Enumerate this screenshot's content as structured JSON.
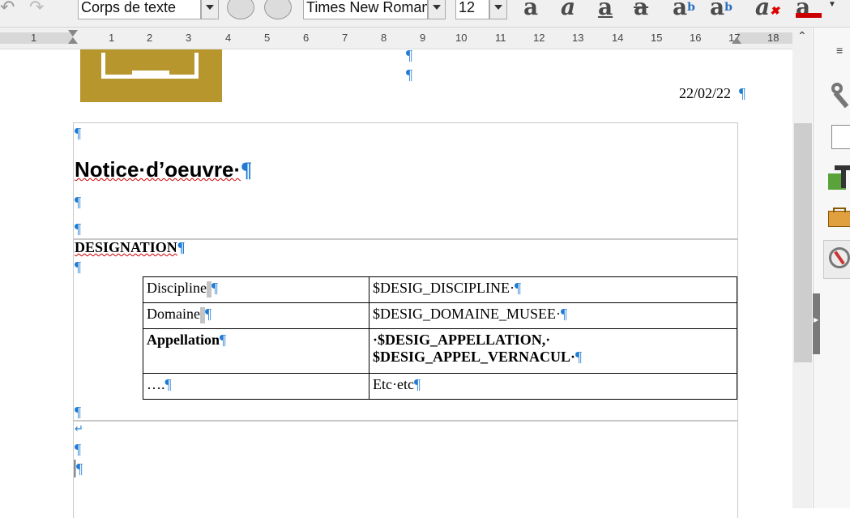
{
  "toolbar": {
    "paragraph_style": "Corps de texte",
    "font_name": "Times New Roman",
    "font_size": "12",
    "icons": [
      "undo-icon",
      "redo-icon",
      "update-style-icon",
      "new-style-icon",
      "bold-icon",
      "italic-icon",
      "underline-icon",
      "strikethrough-icon",
      "superscript-icon",
      "subscript-icon",
      "clear-formatting-icon",
      "font-color-icon"
    ],
    "font_color": "#cc0000"
  },
  "ruler": {
    "labels": [
      "1",
      "1",
      "2",
      "3",
      "4",
      "5",
      "6",
      "7",
      "8",
      "9",
      "10",
      "11",
      "12",
      "13",
      "14",
      "15",
      "16",
      "17",
      "18"
    ]
  },
  "document": {
    "date": "22/02/22",
    "title": "Notice·d’oeuvre·",
    "section": "DESIGNATION",
    "pilcrow": "¶",
    "return_mark": "↵",
    "table": [
      {
        "label": "Discipline",
        "value": "$DESIG_DISCIPLINE·"
      },
      {
        "label": "Domaine",
        "value": "$DESIG_DOMAINE_MUSEE·"
      },
      {
        "label": "Appellation",
        "value_line1": "·$DESIG_APPELLATION,·",
        "value_line2": "$DESIG_APPEL_VERNACUL·"
      },
      {
        "label": "….",
        "value": "Etc·etc"
      }
    ]
  },
  "colors": {
    "logo_background": "#b8962e",
    "formatting_marks": "#1f7bd4"
  }
}
